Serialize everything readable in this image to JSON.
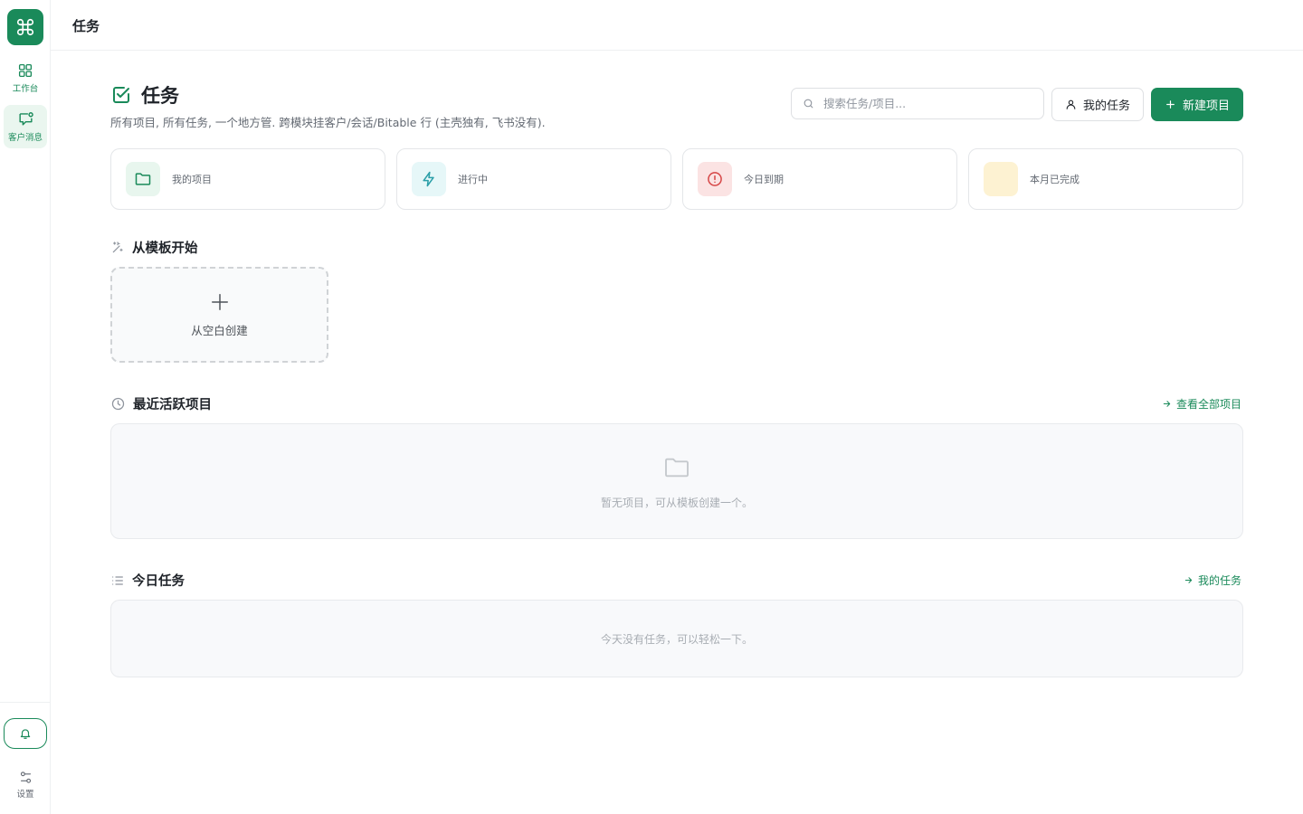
{
  "sidebar": {
    "items": [
      {
        "label": "工作台",
        "icon": "grid-icon"
      },
      {
        "label": "客户消息",
        "icon": "message-icon"
      }
    ],
    "settings_label": "设置"
  },
  "topbar": {
    "title": "任务"
  },
  "header": {
    "title": "任务",
    "subtitle": "所有项目, 所有任务, 一个地方管. 跨模块挂客户/会话/Bitable 行 (主壳独有, 飞书没有).",
    "search_placeholder": "搜索任务/项目...",
    "my_tasks_label": "我的任务",
    "new_project_label": "新建项目"
  },
  "stats": [
    {
      "label": "我的项目",
      "icon": "folder-icon",
      "color": "#1a8a5a",
      "bg": "#e8f6ee"
    },
    {
      "label": "进行中",
      "icon": "bolt-icon",
      "color": "#2b9fa8",
      "bg": "#e6f7f8"
    },
    {
      "label": "今日到期",
      "icon": "alert-icon",
      "color": "#d64545",
      "bg": "#fbe3e3"
    },
    {
      "label": "本月已完成",
      "icon": "check-icon",
      "color": "#e8b43a",
      "bg": "#fdf2d2"
    }
  ],
  "templates": {
    "title": "从模板开始",
    "blank_label": "从空白创建"
  },
  "recent": {
    "title": "最近活跃项目",
    "link_label": "查看全部项目",
    "empty_text": "暂无项目，可从模板创建一个。"
  },
  "today": {
    "title": "今日任务",
    "link_label": "我的任务",
    "empty_text": "今天没有任务，可以轻松一下。"
  },
  "colors": {
    "accent": "#1a8a5a"
  }
}
